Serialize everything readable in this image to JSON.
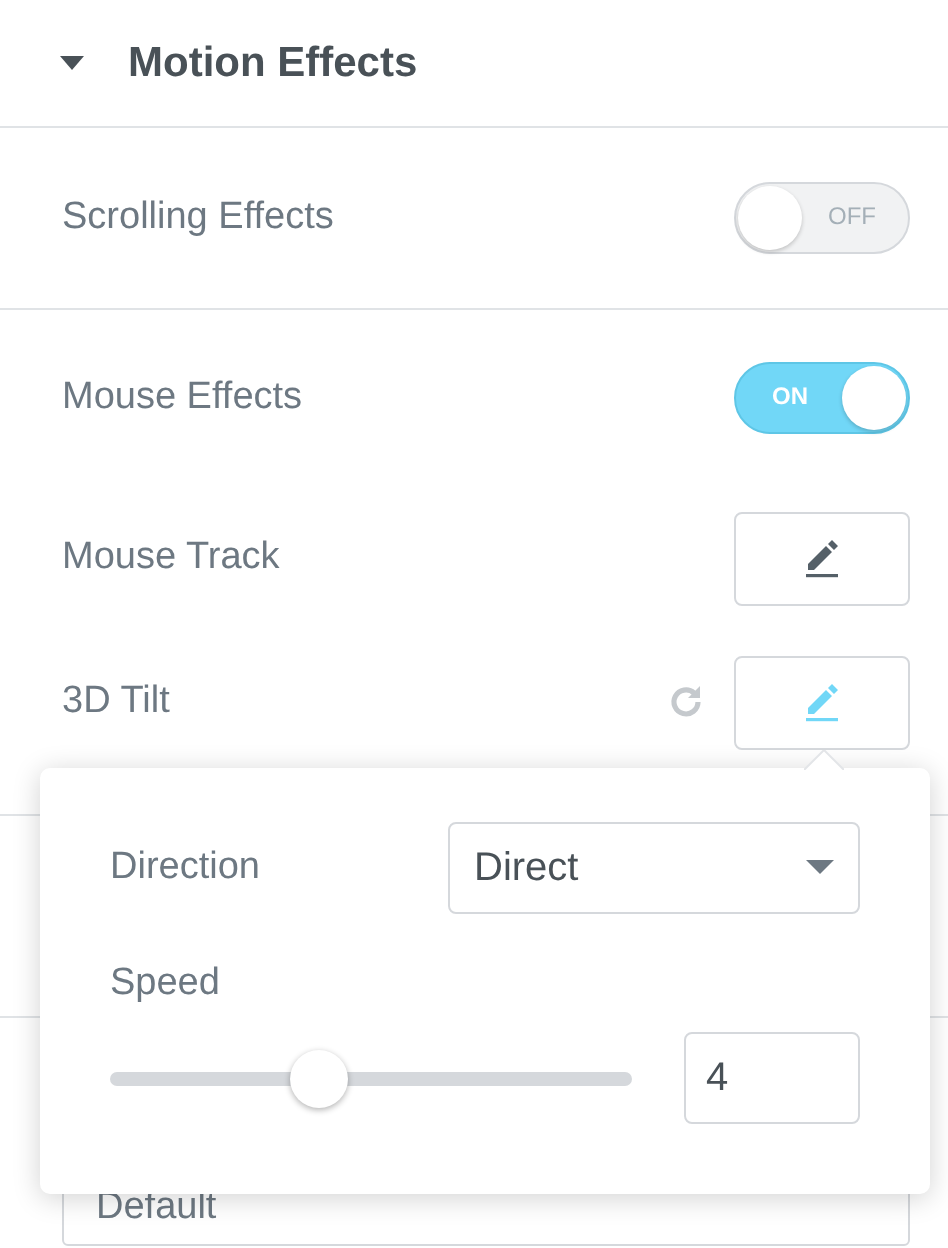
{
  "section": {
    "title": "Motion Effects",
    "expanded": true
  },
  "rows": [
    {
      "kind": "toggle",
      "label": "Scrolling Effects",
      "on": false,
      "text": "OFF"
    },
    {
      "kind": "toggle",
      "label": "Mouse Effects",
      "on": true,
      "text": "ON"
    },
    {
      "kind": "edit",
      "label": "Mouse Track",
      "active": false,
      "reset": false
    },
    {
      "kind": "edit",
      "label": "3D Tilt",
      "active": true,
      "reset": true
    }
  ],
  "popover": {
    "direction": {
      "label": "Direction",
      "value": "Direct"
    },
    "speed": {
      "label": "Speed",
      "level": 0.4,
      "value": "4"
    }
  },
  "background_field": {
    "value": "Default"
  }
}
